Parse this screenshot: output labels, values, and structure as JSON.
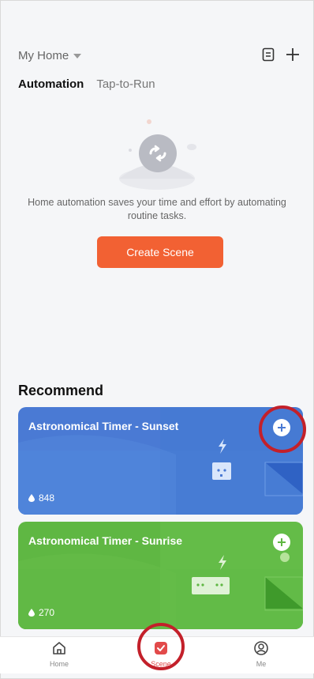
{
  "header": {
    "home_name": "My Home",
    "icons": [
      "log-icon",
      "plus-icon"
    ]
  },
  "tabs": [
    {
      "label": "Automation",
      "active": true
    },
    {
      "label": "Tap-to-Run",
      "active": false
    }
  ],
  "empty_state": {
    "text": "Home automation saves your time and effort by automating routine tasks.",
    "button_label": "Create Scene"
  },
  "recommend": {
    "title": "Recommend",
    "cards": [
      {
        "title": "Astronomical Timer - Sunset",
        "count": "848",
        "color": "#4a7ad4"
      },
      {
        "title": "Astronomical Timer - Sunrise",
        "count": "270",
        "color": "#5fb743"
      }
    ]
  },
  "tabbar": {
    "items": [
      {
        "label": "Home",
        "icon": "home-icon"
      },
      {
        "label": "Scene",
        "icon": "scene-icon",
        "active": true
      },
      {
        "label": "Me",
        "icon": "profile-icon"
      }
    ]
  },
  "colors": {
    "accent": "#f26133",
    "highlight": "#c3202a"
  }
}
